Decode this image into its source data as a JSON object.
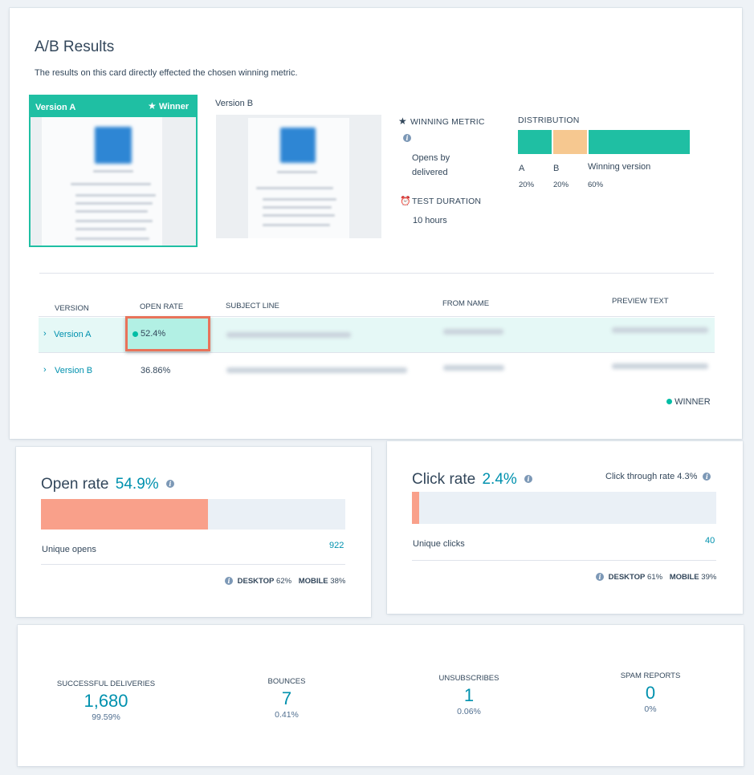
{
  "ab": {
    "title": "A/B Results",
    "subtitle": "The results on this card directly effected the chosen winning metric.",
    "version_a": {
      "label": "Version A",
      "winner_label": "Winner"
    },
    "version_b": {
      "label": "Version B"
    },
    "winning_metric": {
      "label": "WINNING METRIC",
      "value_line1": "Opens by",
      "value_line2": "delivered"
    },
    "test_duration": {
      "label": "TEST DURATION",
      "value": "10 hours"
    },
    "distribution": {
      "label": "DISTRIBUTION",
      "segments": [
        {
          "name": "A",
          "pct": "20%",
          "share": 20,
          "color": "#1fbfa3"
        },
        {
          "name": "B",
          "pct": "20%",
          "share": 20,
          "color": "#f6c890"
        },
        {
          "name": "Winning version",
          "pct": "60%",
          "share": 60,
          "color": "#1fbfa3"
        }
      ]
    },
    "table": {
      "headers": [
        "VERSION",
        "OPEN RATE",
        "SUBJECT LINE",
        "FROM NAME",
        "PREVIEW TEXT"
      ],
      "rows": [
        {
          "version": "Version A",
          "open_rate": "52.4%"
        },
        {
          "version": "Version B",
          "open_rate": "36.86%"
        }
      ],
      "winner_legend": "WINNER"
    }
  },
  "open_rate": {
    "title": "Open rate",
    "value": "54.9%",
    "fill": 0.549,
    "fill_color": "#f9a08a",
    "unique_label": "Unique opens",
    "unique_value": "922",
    "desktop_label": "DESKTOP",
    "desktop_pct": "62%",
    "mobile_label": "MOBILE",
    "mobile_pct": "38%"
  },
  "click_rate": {
    "title": "Click rate",
    "value": "2.4%",
    "fill": 0.024,
    "fill_color": "#f9a08a",
    "ctr_label": "Click through rate",
    "ctr_value": "4.3%",
    "unique_label": "Unique clicks",
    "unique_value": "40",
    "desktop_label": "DESKTOP",
    "desktop_pct": "61%",
    "mobile_label": "MOBILE",
    "mobile_pct": "39%"
  },
  "stats": [
    {
      "label": "SUCCESSFUL DELIVERIES",
      "value": "1,680",
      "pct": "99.59%"
    },
    {
      "label": "BOUNCES",
      "value": "7",
      "pct": "0.41%"
    },
    {
      "label": "UNSUBSCRIBES",
      "value": "1",
      "pct": "0.06%"
    },
    {
      "label": "SPAM REPORTS",
      "value": "0",
      "pct": "0%"
    }
  ],
  "colors": {
    "teal": "#00bda5",
    "link": "#0091ae",
    "winner_row": "#e5f8f6",
    "highlight": "#b2f0e4",
    "highlight_border": "#e8735a"
  },
  "icons": {
    "winner": "star-icon",
    "metric": "star-icon",
    "duration": "alarm-clock-icon",
    "info": "info-icon",
    "row": "chevron-right-icon"
  }
}
